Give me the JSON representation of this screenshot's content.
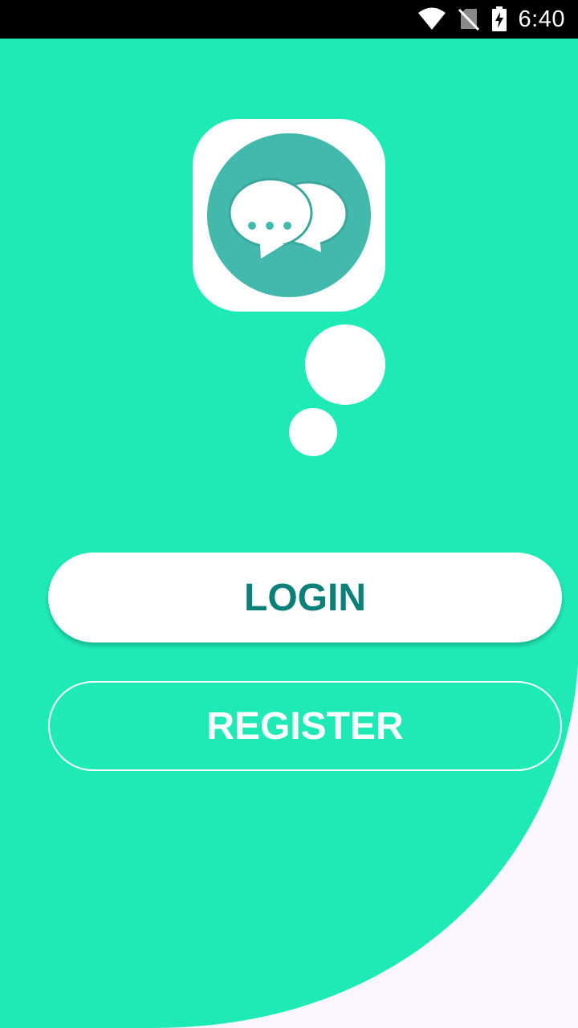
{
  "status_bar": {
    "time": "6:40",
    "icons": [
      "wifi-icon",
      "no-sim-icon",
      "battery-charging-icon"
    ]
  },
  "logo": {
    "icon": "chat-bubbles-icon"
  },
  "buttons": {
    "login_label": "LOGIN",
    "register_label": "REGISTER"
  },
  "colors": {
    "primary": "#1eeab6",
    "logo_circle": "#43b9ad",
    "login_text": "#0b8078",
    "corner_background": "#fbf5fd",
    "status_bar": "#000000"
  }
}
